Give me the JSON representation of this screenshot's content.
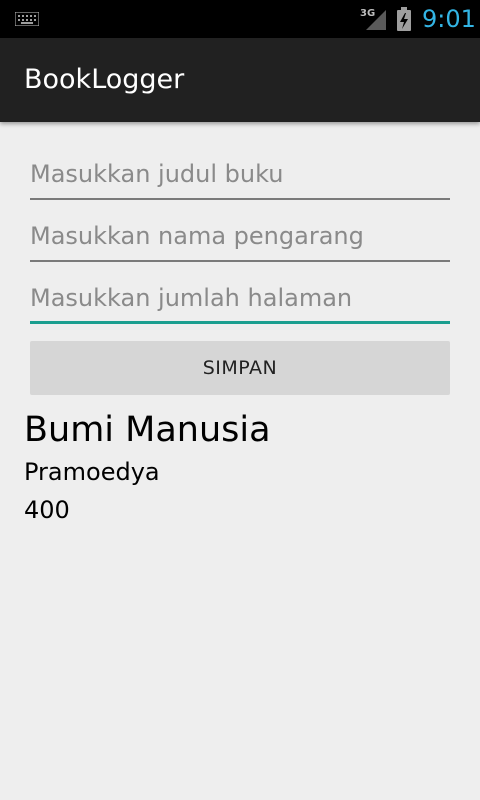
{
  "status_bar": {
    "network_label": "3G",
    "time": "9:01",
    "icons": [
      "keyboard-icon",
      "signal-3g-icon",
      "battery-charging-icon"
    ],
    "time_color": "#33b5e5"
  },
  "action_bar": {
    "title": "BookLogger"
  },
  "form": {
    "title_field": {
      "placeholder": "Masukkan judul buku",
      "value": ""
    },
    "author_field": {
      "placeholder": "Masukkan nama pengarang",
      "value": ""
    },
    "pages_field": {
      "placeholder": "Masukkan jumlah halaman",
      "value": ""
    },
    "save_label": "SIMPAN",
    "accent_color": "#1a9e8f"
  },
  "book": {
    "title": "Bumi Manusia",
    "author": "Pramoedya",
    "pages": "400"
  }
}
